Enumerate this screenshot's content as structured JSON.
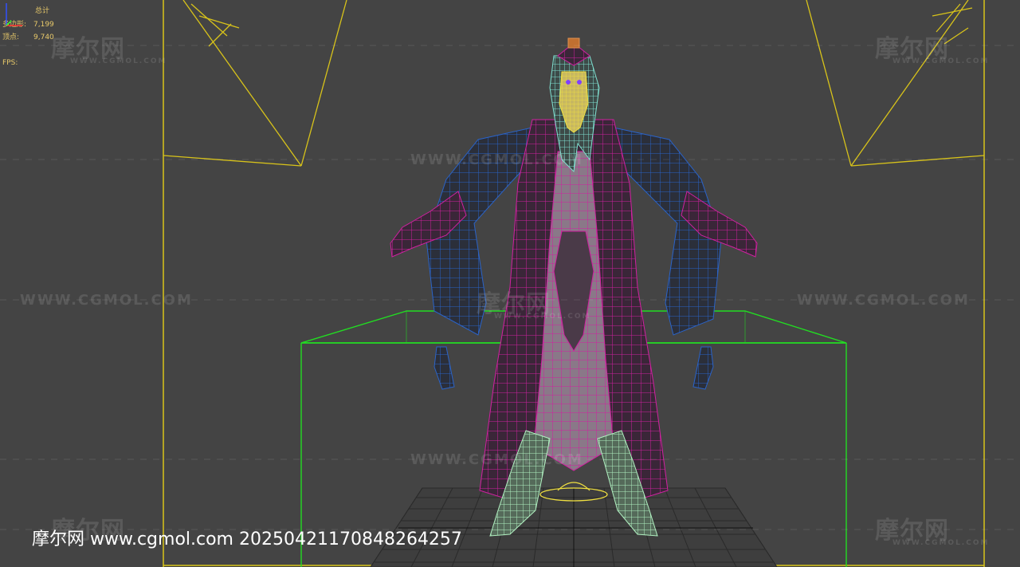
{
  "stats": {
    "header": "总计",
    "polygons_label": "多边形:",
    "polygons_value": "7,199",
    "vertices_label": "顶点:",
    "vertices_value": "9,740",
    "fps_label": "FPS:"
  },
  "watermark": {
    "logo": "摩尔网",
    "sub": "WWW.CGMOL.COM",
    "url": "WWW.CGMOL.COM"
  },
  "footer": {
    "stamp": "摩尔网 www.cgmol.com 20250421170848264257"
  },
  "colors": {
    "background": "#444444",
    "camera": "#d8c31a",
    "bounding_box": "#22dd22",
    "robe_wire": "#d020a0",
    "sleeve_wire": "#2a63c8",
    "hair_wire": "#7fe0d0",
    "stats_text": "#e8c96a"
  }
}
